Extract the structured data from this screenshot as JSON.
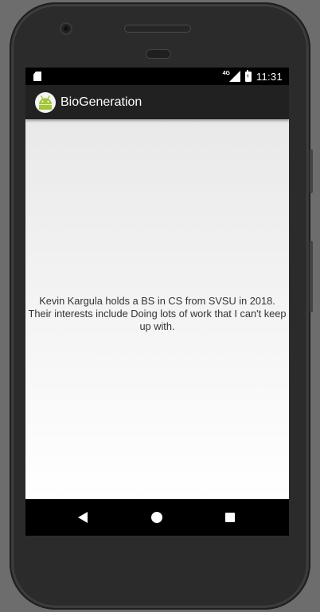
{
  "status_bar": {
    "network": "4G",
    "time": "11:31"
  },
  "app_bar": {
    "title": "BioGeneration",
    "icon": "android-icon"
  },
  "content": {
    "bio_text": "Kevin  Kargula holds a BS in CS from SVSU in 2018. Their interests include Doing lots of work that I can't keep up with."
  },
  "nav_bar": {
    "back": "back-icon",
    "home": "home-icon",
    "recents": "recents-icon"
  },
  "colors": {
    "app_bar": "#212121",
    "android_green": "#a4c639"
  }
}
